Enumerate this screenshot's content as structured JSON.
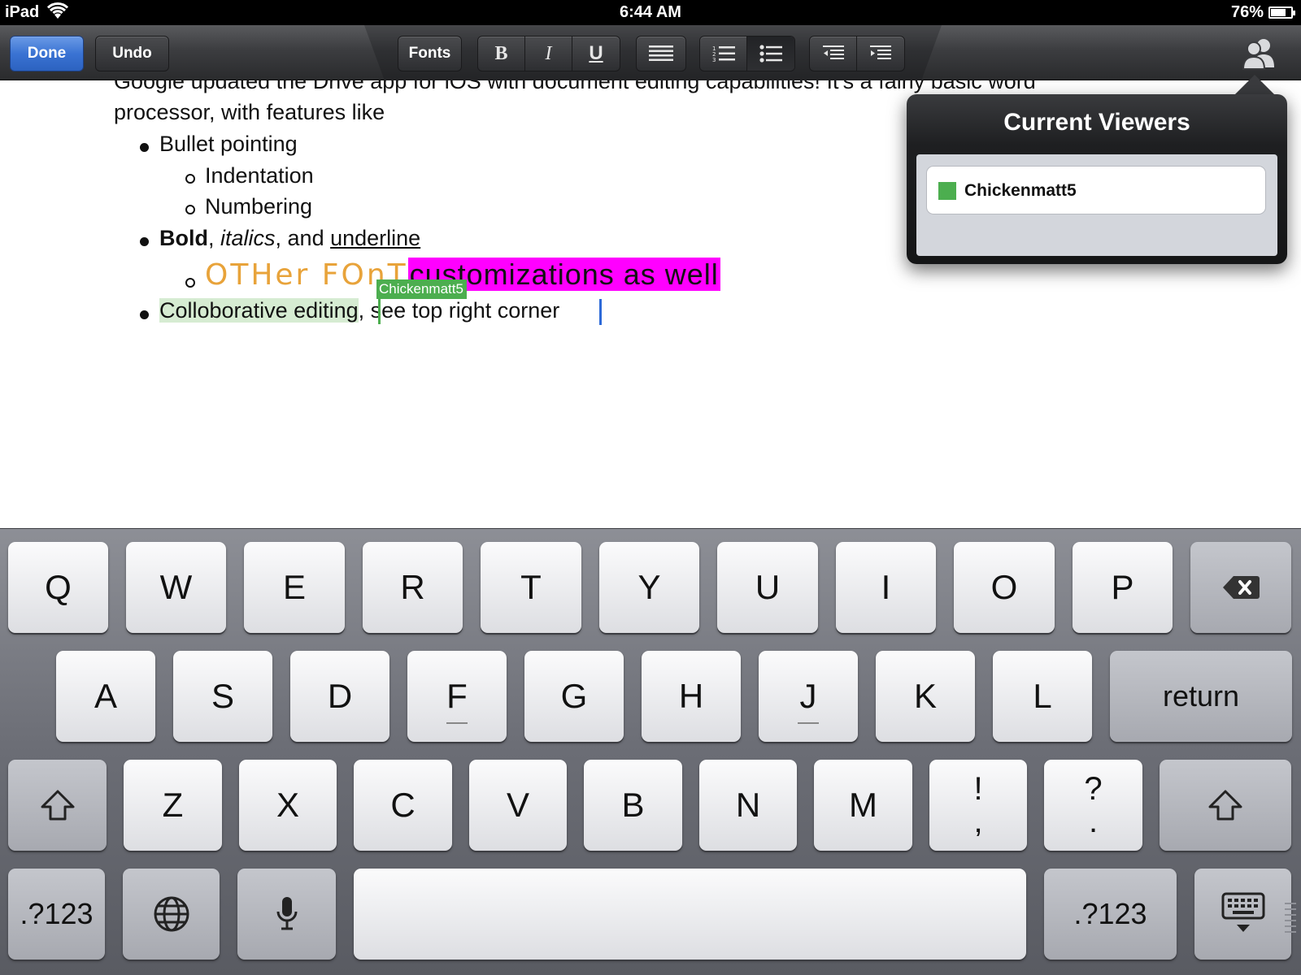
{
  "status_bar": {
    "carrier": "iPad",
    "time": "6:44 AM",
    "battery_percent": "76%",
    "battery_level": 0.76
  },
  "toolbar": {
    "done_label": "Done",
    "undo_label": "Undo",
    "fonts_label": "Fonts",
    "bold_label": "B",
    "italic_label": "I",
    "underline_label": "U",
    "accent_color": "#3a73d3",
    "icons": [
      "bold-icon",
      "italic-icon",
      "underline-icon",
      "align-left-icon",
      "numbered-list-icon",
      "bulleted-list-icon",
      "outdent-icon",
      "indent-icon",
      "people-icon"
    ]
  },
  "document": {
    "intro_line1": "Google updated the Drive app for iOS with document editing capabilities! It's a fairly basic word",
    "intro_line2": "processor, with features like",
    "bullet1": "Bullet pointing",
    "sub1": "Indentation",
    "sub2": "Numbering",
    "bold_word": "Bold",
    "comma1": ", ",
    "italic_word": "italics",
    "and_text": ", and ",
    "underline_word": "underline",
    "fancy_text": "OTHer FOnT",
    "highlight_text": "customizations as well",
    "collab_text": "Colloborative editing",
    "collab_rest": ", see top right corner",
    "collaborator_tag": "Chickenmatt5",
    "colors": {
      "fancy": "#e8a33a",
      "highlight": "#ff00ff",
      "collaborator": "#4cae4f",
      "caret": "#2d6ad8"
    }
  },
  "viewers_popover": {
    "title": "Current Viewers",
    "viewers": [
      {
        "name": "Chickenmatt5",
        "color": "#4cae4f"
      }
    ]
  },
  "keyboard": {
    "row1": [
      "Q",
      "W",
      "E",
      "R",
      "T",
      "Y",
      "U",
      "I",
      "O",
      "P"
    ],
    "row2": [
      "A",
      "S",
      "D",
      "F",
      "G",
      "H",
      "J",
      "K",
      "L"
    ],
    "return_label": "return",
    "row3": [
      "Z",
      "X",
      "C",
      "V",
      "B",
      "N",
      "M"
    ],
    "exclam_top": "!",
    "exclam_bottom": ",",
    "question_top": "?",
    "question_bottom": ".",
    "numbers_left": ".?123",
    "numbers_right": ".?123"
  }
}
